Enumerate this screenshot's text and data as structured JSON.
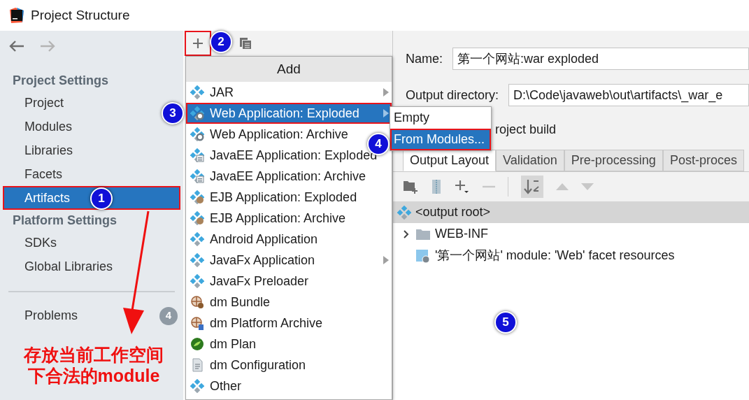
{
  "window": {
    "title": "Project Structure"
  },
  "sidebar": {
    "back_enabled": true,
    "forward_enabled": false,
    "sections": [
      {
        "title": "Project Settings",
        "items": [
          {
            "label": "Project",
            "selected": false,
            "annotated": false
          },
          {
            "label": "Modules",
            "selected": false,
            "annotated": false
          },
          {
            "label": "Libraries",
            "selected": false,
            "annotated": false
          },
          {
            "label": "Facets",
            "selected": false,
            "annotated": false
          },
          {
            "label": "Artifacts",
            "selected": true,
            "annotated": true
          }
        ]
      },
      {
        "title": "Platform Settings",
        "items": [
          {
            "label": "SDKs",
            "selected": false,
            "annotated": false
          },
          {
            "label": "Global Libraries",
            "selected": false,
            "annotated": false
          }
        ]
      }
    ],
    "problems": {
      "label": "Problems",
      "count": "4"
    }
  },
  "artifact_toolbar": {
    "add_annotated": true
  },
  "add_menu": {
    "title": "Add",
    "items": [
      {
        "label": "JAR",
        "kind": "artifact",
        "submenu": true,
        "selected": false,
        "annotated": false
      },
      {
        "label": "Web Application: Exploded",
        "kind": "web",
        "submenu": true,
        "selected": true,
        "annotated": true
      },
      {
        "label": "Web Application: Archive",
        "kind": "web",
        "submenu": false,
        "selected": false,
        "annotated": false
      },
      {
        "label": "JavaEE Application: Exploded",
        "kind": "javaee",
        "submenu": false,
        "selected": false,
        "annotated": false
      },
      {
        "label": "JavaEE Application: Archive",
        "kind": "javaee",
        "submenu": false,
        "selected": false,
        "annotated": false
      },
      {
        "label": "EJB Application: Exploded",
        "kind": "ejb",
        "submenu": false,
        "selected": false,
        "annotated": false
      },
      {
        "label": "EJB Application: Archive",
        "kind": "ejb",
        "submenu": false,
        "selected": false,
        "annotated": false
      },
      {
        "label": "Android Application",
        "kind": "artifact",
        "submenu": false,
        "selected": false,
        "annotated": false
      },
      {
        "label": "JavaFx Application",
        "kind": "artifact",
        "submenu": true,
        "selected": false,
        "annotated": false
      },
      {
        "label": "JavaFx Preloader",
        "kind": "artifact",
        "submenu": false,
        "selected": false,
        "annotated": false
      },
      {
        "label": "dm Bundle",
        "kind": "bundle",
        "submenu": false,
        "selected": false,
        "annotated": false
      },
      {
        "label": "dm Platform Archive",
        "kind": "archive",
        "submenu": false,
        "selected": false,
        "annotated": false
      },
      {
        "label": "dm Plan",
        "kind": "plan",
        "submenu": false,
        "selected": false,
        "annotated": false
      },
      {
        "label": "dm Configuration",
        "kind": "document",
        "submenu": false,
        "selected": false,
        "annotated": false
      },
      {
        "label": "Other",
        "kind": "artifact",
        "submenu": false,
        "selected": false,
        "annotated": false
      }
    ]
  },
  "sub_menu": {
    "items": [
      {
        "label": "Empty",
        "selected": false,
        "annotated": false
      },
      {
        "label": "From Modules...",
        "selected": true,
        "annotated": true
      }
    ]
  },
  "details": {
    "name_label": "Name:",
    "name_value": "第一个网站:war exploded",
    "output_label": "Output directory:",
    "output_value": "D:\\Code\\javaweb\\out\\artifacts\\_war_e",
    "build_fragment": "roject build",
    "tabs": [
      {
        "label": "Output Layout",
        "selected": true
      },
      {
        "label": "Validation",
        "selected": false
      },
      {
        "label": "Pre-processing",
        "selected": false
      },
      {
        "label": "Post-proces",
        "selected": false
      }
    ],
    "tree": [
      {
        "label": "<output root>",
        "kind": "artifact",
        "selected": true
      },
      {
        "label": "WEB-INF",
        "kind": "folder",
        "selected": false,
        "expanded": false
      },
      {
        "label": "'第一个网站' module: 'Web' facet resources",
        "kind": "resource",
        "selected": false
      }
    ]
  },
  "annotations": {
    "markers": [
      "1",
      "2",
      "3",
      "4",
      "5"
    ],
    "note_lines": [
      "存放当前工作空间",
      "下合法的module"
    ]
  }
}
